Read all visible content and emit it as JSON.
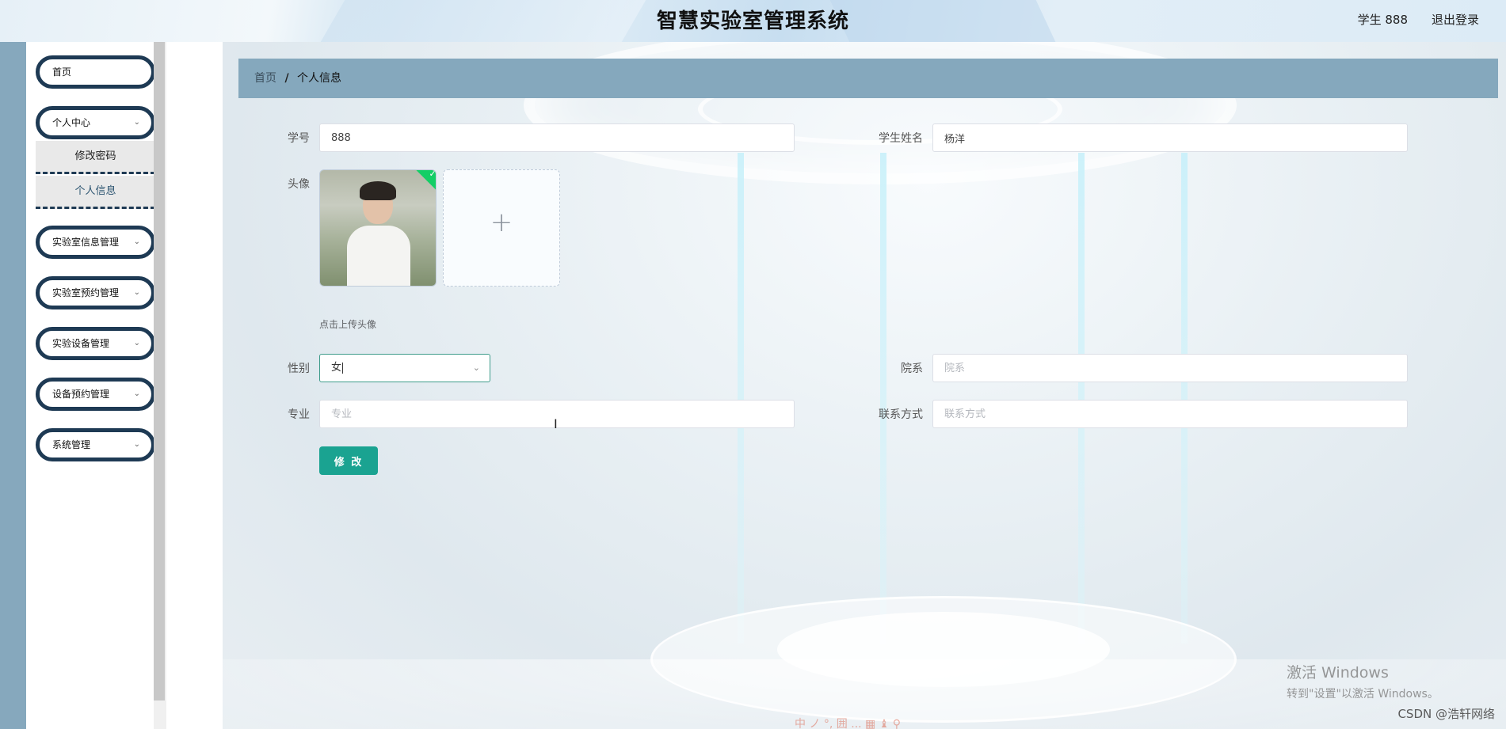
{
  "header": {
    "title": "智慧实验室管理系统",
    "user_label": "学生 888",
    "logout_label": "退出登录"
  },
  "sidebar": {
    "items": [
      {
        "label": "首页",
        "has_chevron": false
      },
      {
        "label": "个人中心",
        "has_chevron": true,
        "expanded": true,
        "children": [
          {
            "label": "修改密码"
          },
          {
            "label": "个人信息",
            "active": true
          }
        ]
      },
      {
        "label": "实验室信息管理",
        "has_chevron": true
      },
      {
        "label": "实验室预约管理",
        "has_chevron": true
      },
      {
        "label": "实验设备管理",
        "has_chevron": true
      },
      {
        "label": "设备预约管理",
        "has_chevron": true
      },
      {
        "label": "系统管理",
        "has_chevron": true
      }
    ]
  },
  "breadcrumb": {
    "home": "首页",
    "separator": "/",
    "current": "个人信息"
  },
  "form": {
    "student_no": {
      "label": "学号",
      "value": "888"
    },
    "student_name": {
      "label": "学生姓名",
      "value": "杨洋"
    },
    "avatar": {
      "label": "头像",
      "upload_hint": "点击上传头像",
      "plus": "+",
      "check": "✓"
    },
    "gender": {
      "label": "性别",
      "value": "女"
    },
    "department": {
      "label": "院系",
      "value": "",
      "placeholder": "院系"
    },
    "major": {
      "label": "专业",
      "value": "",
      "placeholder": "专业"
    },
    "contact": {
      "label": "联系方式",
      "value": "",
      "placeholder": "联系方式"
    },
    "submit_label": "修 改"
  },
  "watermark": {
    "line1": "激活 Windows",
    "line2": "转到\"设置\"以激活 Windows。",
    "source": "CSDN @浩轩网络"
  },
  "ime": {
    "text": "中 ノ °, 囲 ... ▦ ♝ ⚲"
  },
  "icons": {
    "chevron": "chevron-down-icon",
    "cursor": "text-cursor-icon"
  },
  "colors": {
    "nav_border": "#1e3a54",
    "breadcrumb_bg": "#85a8bd",
    "accent": "#1aa391",
    "avatar_check": "#13ce66"
  }
}
